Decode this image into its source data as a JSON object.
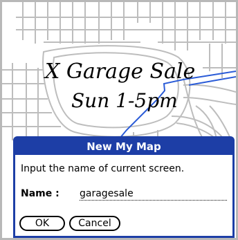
{
  "map": {
    "handwriting_line1": "X Garage Sale",
    "handwriting_line2": "Sun 1-5pm",
    "road_color": "#bdbdbd",
    "route_color": "#2a5bd7"
  },
  "dialog": {
    "title": "New My Map",
    "prompt": "Input the name of current screen.",
    "name_label": "Name :",
    "name_value": "garagesale",
    "ok_label": "OK",
    "cancel_label": "Cancel",
    "accent_color": "#1d3ea6"
  }
}
